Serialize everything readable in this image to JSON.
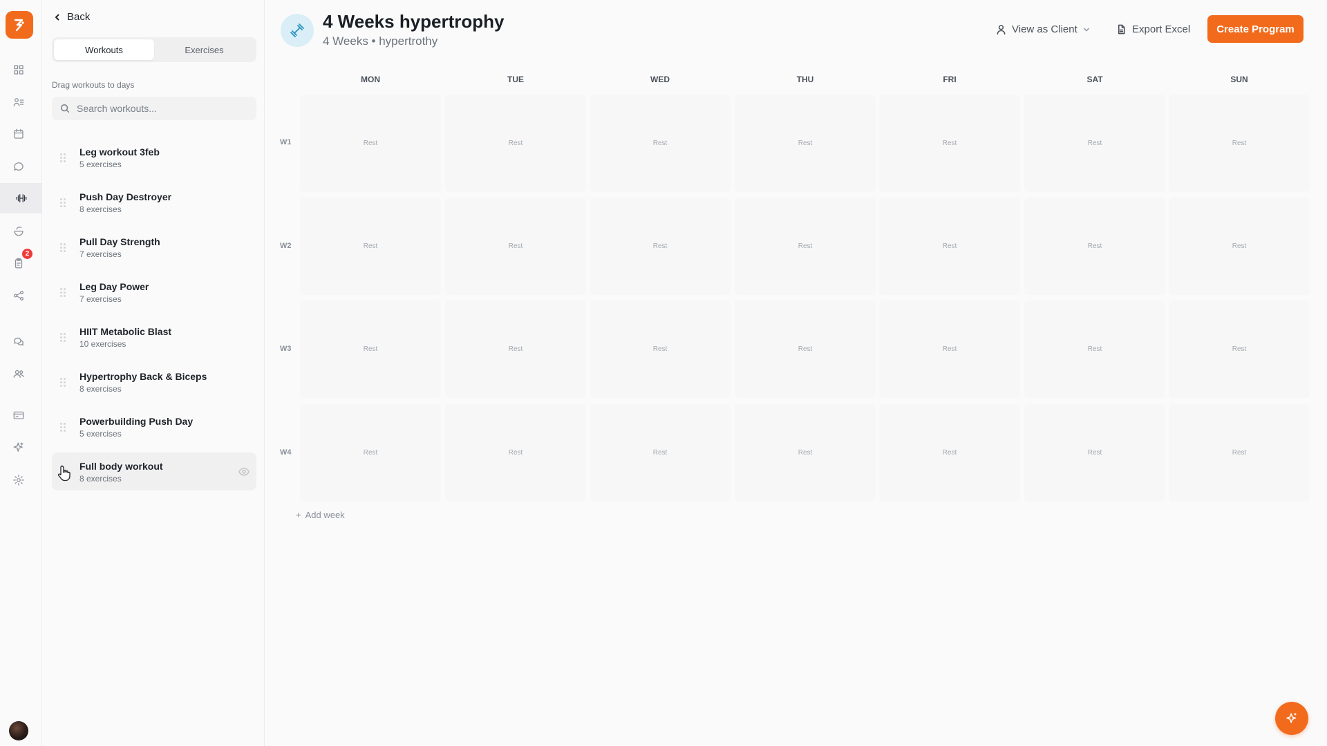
{
  "colors": {
    "accent": "#f26b1d",
    "program_icon_bg": "#d9eef6",
    "badge": "#ef3b3b"
  },
  "rail": {
    "icons": [
      "dashboard-icon",
      "clients-icon",
      "calendar-icon",
      "messages-icon",
      "dumbbell-icon",
      "nutrition-icon",
      "clipboard-icon",
      "automations-icon",
      "community-icon",
      "team-icon",
      "payments-icon",
      "ai-sparkle-icon",
      "settings-icon"
    ],
    "badge_count": "2"
  },
  "panel": {
    "back_label": "Back",
    "tabs": [
      {
        "label": "Workouts",
        "active": true
      },
      {
        "label": "Exercises",
        "active": false
      }
    ],
    "hint": "Drag workouts to days",
    "search_placeholder": "Search workouts...",
    "workouts": [
      {
        "name": "Leg workout 3feb",
        "count": "5 exercises"
      },
      {
        "name": "Push Day Destroyer",
        "count": "8 exercises"
      },
      {
        "name": "Pull Day Strength",
        "count": "7 exercises"
      },
      {
        "name": "Leg Day Power",
        "count": "7 exercises"
      },
      {
        "name": "HIIT Metabolic Blast",
        "count": "10 exercises"
      },
      {
        "name": "Hypertrophy Back & Biceps",
        "count": "8 exercises"
      },
      {
        "name": "Powerbuilding Push Day",
        "count": "5 exercises"
      },
      {
        "name": "Full body workout",
        "count": "8 exercises"
      }
    ]
  },
  "header": {
    "title": "4 Weeks hypertrophy",
    "subtitle": "4 Weeks • hypertrothy",
    "view_as_client": "View as Client",
    "export_excel": "Export Excel",
    "create_program": "Create Program"
  },
  "calendar": {
    "days": [
      "MON",
      "TUE",
      "WED",
      "THU",
      "FRI",
      "SAT",
      "SUN"
    ],
    "weeks": [
      {
        "label": "W1",
        "cells": [
          "Rest",
          "Rest",
          "Rest",
          "Rest",
          "Rest",
          "Rest",
          "Rest"
        ]
      },
      {
        "label": "W2",
        "cells": [
          "Rest",
          "Rest",
          "Rest",
          "Rest",
          "Rest",
          "Rest",
          "Rest"
        ]
      },
      {
        "label": "W3",
        "cells": [
          "Rest",
          "Rest",
          "Rest",
          "Rest",
          "Rest",
          "Rest",
          "Rest"
        ]
      },
      {
        "label": "W4",
        "cells": [
          "Rest",
          "Rest",
          "Rest",
          "Rest",
          "Rest",
          "Rest",
          "Rest"
        ]
      }
    ],
    "add_week": "Add week"
  }
}
